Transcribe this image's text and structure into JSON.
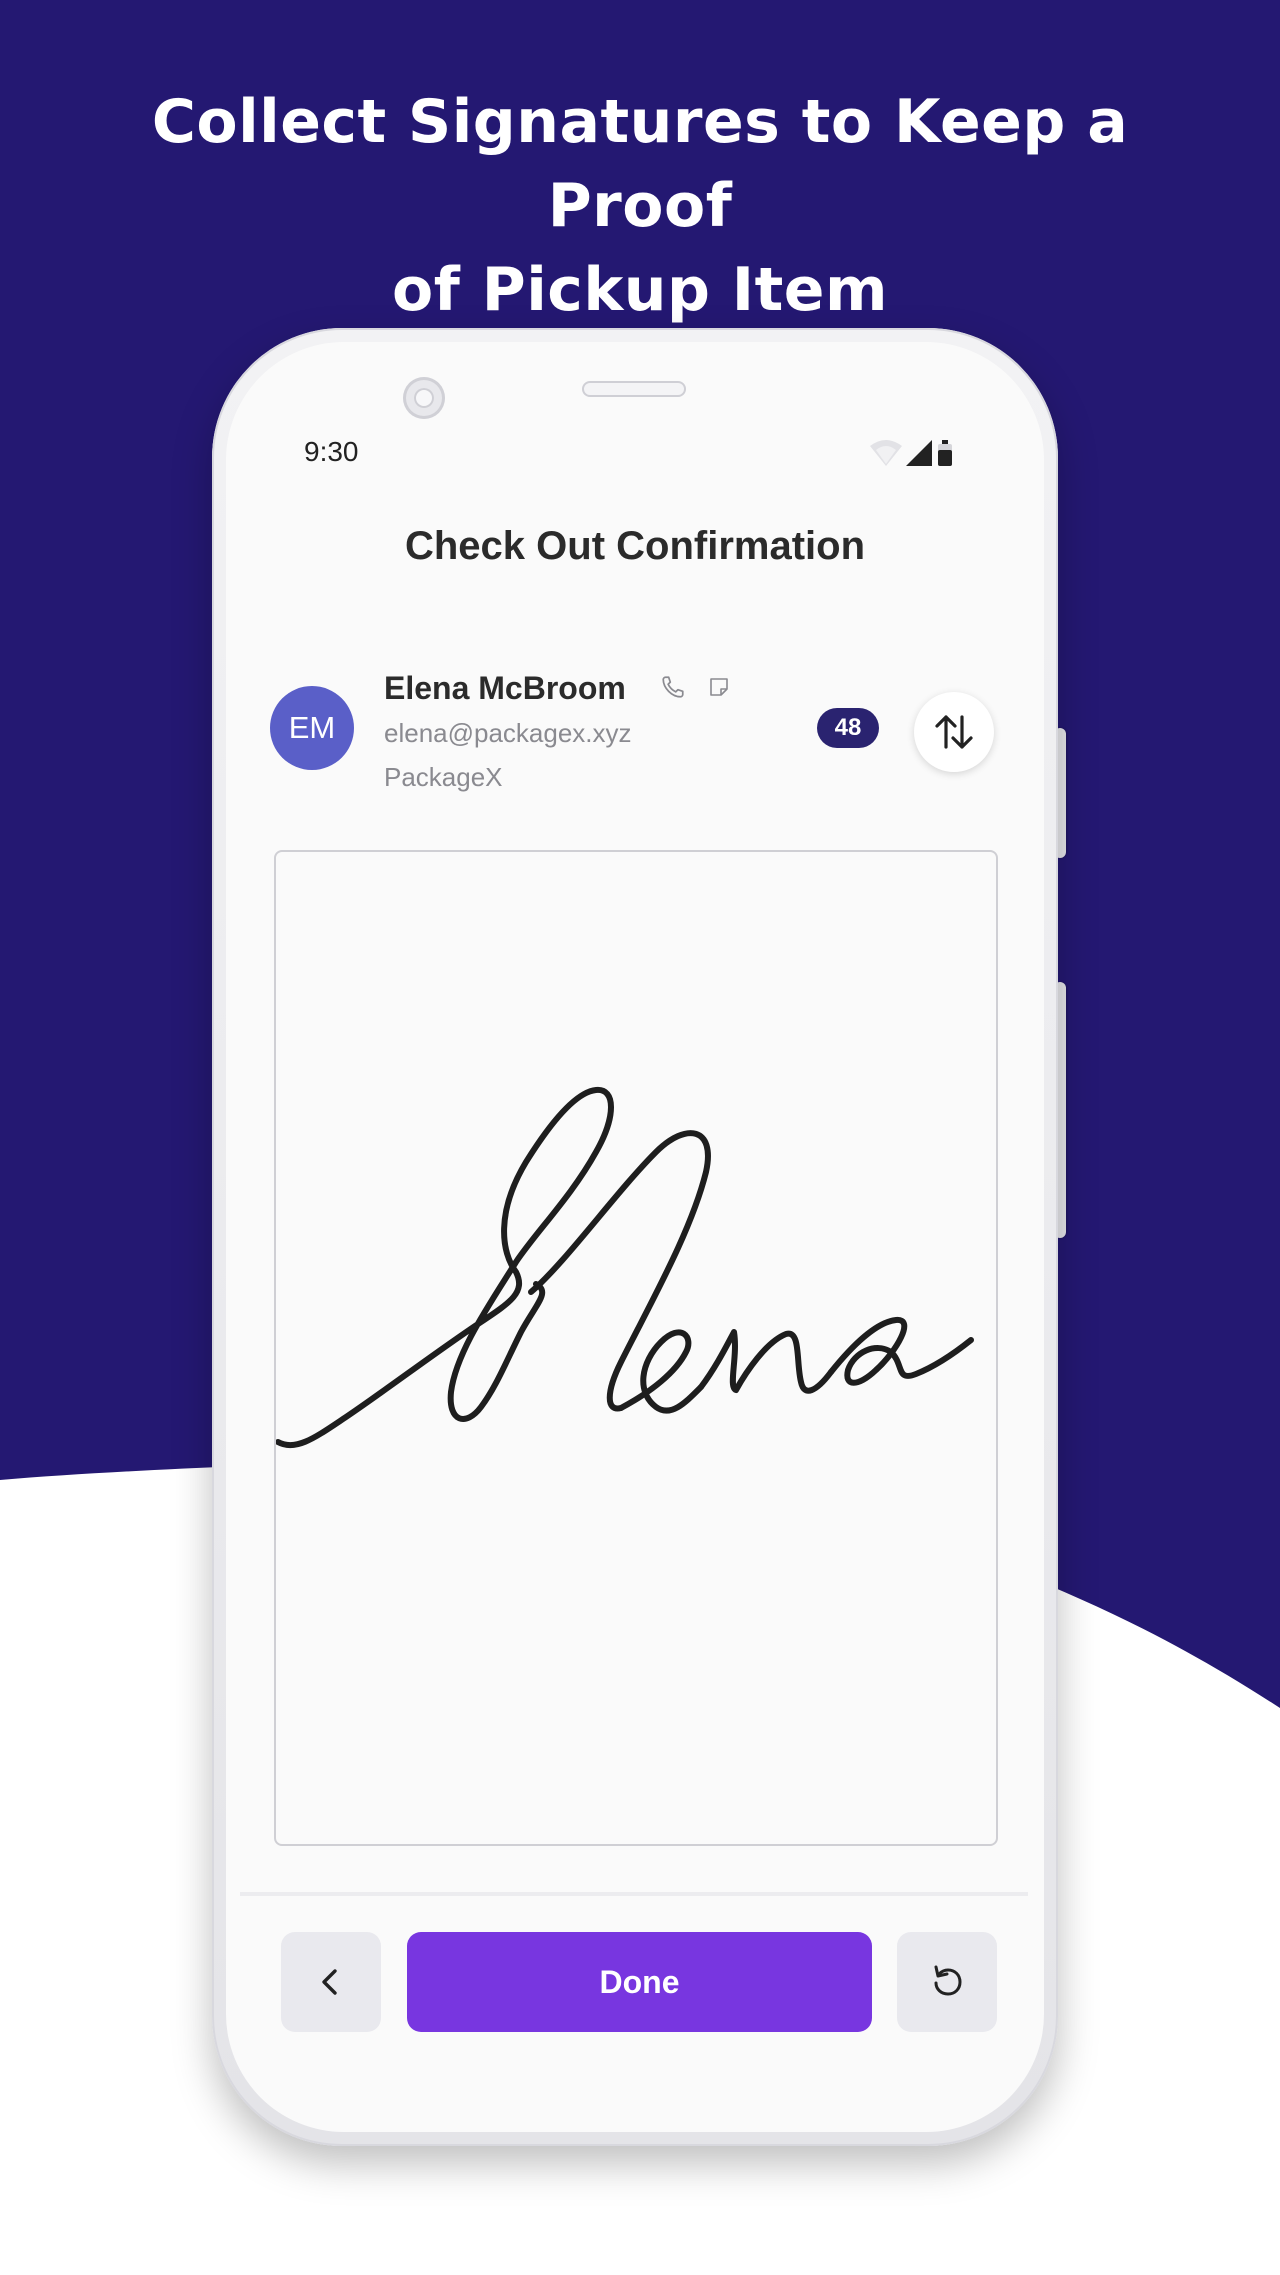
{
  "headline": {
    "line1": "Collect Signatures to Keep a Proof",
    "line2": "of Pickup Item"
  },
  "colors": {
    "background_top": "#241872",
    "background_bottom": "#ffffff",
    "done_button": "#7836e0",
    "avatar": "#5a5fc8",
    "badge": "#2a2370"
  },
  "status_bar": {
    "time": "9:30",
    "icons": [
      "wifi-icon",
      "signal-icon",
      "battery-icon"
    ]
  },
  "screen": {
    "title": "Check Out Confirmation"
  },
  "contact": {
    "initials": "EM",
    "name": "Elena McBroom",
    "email": "elena@packagex.xyz",
    "organization": "PackageX",
    "count": "48",
    "icons": [
      "phone-icon",
      "note-icon",
      "sort-arrows-icon"
    ]
  },
  "signature": {
    "signed_name": "Elena"
  },
  "actions": {
    "done_label": "Done",
    "back_icon": "chevron-left-icon",
    "reset_icon": "rotate-ccw-icon"
  }
}
